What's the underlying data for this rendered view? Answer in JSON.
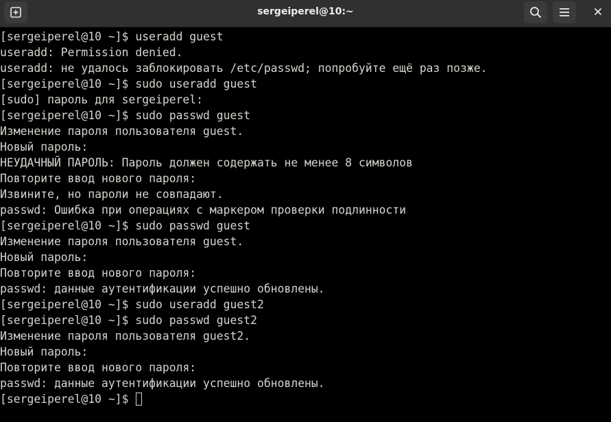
{
  "window": {
    "title": "sergeiperel@10:~"
  },
  "toolbar": {
    "new_tab_icon": "new-tab-plus-icon",
    "search_icon": "search-icon",
    "menu_icon": "hamburger-menu-icon",
    "close_icon": "close-icon"
  },
  "terminal": {
    "lines": [
      "[sergeiperel@10 ~]$ useradd guest",
      "useradd: Permission denied.",
      "useradd: не удалось заблокировать /etc/passwd; попробуйте ещё раз позже.",
      "[sergeiperel@10 ~]$ sudo useradd guest",
      "[sudo] пароль для sergeiperel:",
      "[sergeiperel@10 ~]$ sudo passwd guest",
      "Изменение пароля пользователя guest.",
      "Новый пароль:",
      "НЕУДАЧНЫЙ ПАРОЛЬ: Пароль должен содержать не менее 8 символов",
      "Повторите ввод нового пароля:",
      "Извините, но пароли не совпадают.",
      "passwd: Ошибка при операциях с маркером проверки подлинности",
      "[sergeiperel@10 ~]$ sudo passwd guest",
      "Изменение пароля пользователя guest.",
      "Новый пароль:",
      "Повторите ввод нового пароля:",
      "passwd: данные аутентификации успешно обновлены.",
      "[sergeiperel@10 ~]$ sudo useradd guest2",
      "[sergeiperel@10 ~]$ sudo passwd guest2",
      "Изменение пароля пользователя guest2.",
      "Новый пароль:",
      "Повторите ввод нового пароля:",
      "passwd: данные аутентификации успешно обновлены."
    ],
    "prompt": "[sergeiperel@10 ~]$ "
  }
}
